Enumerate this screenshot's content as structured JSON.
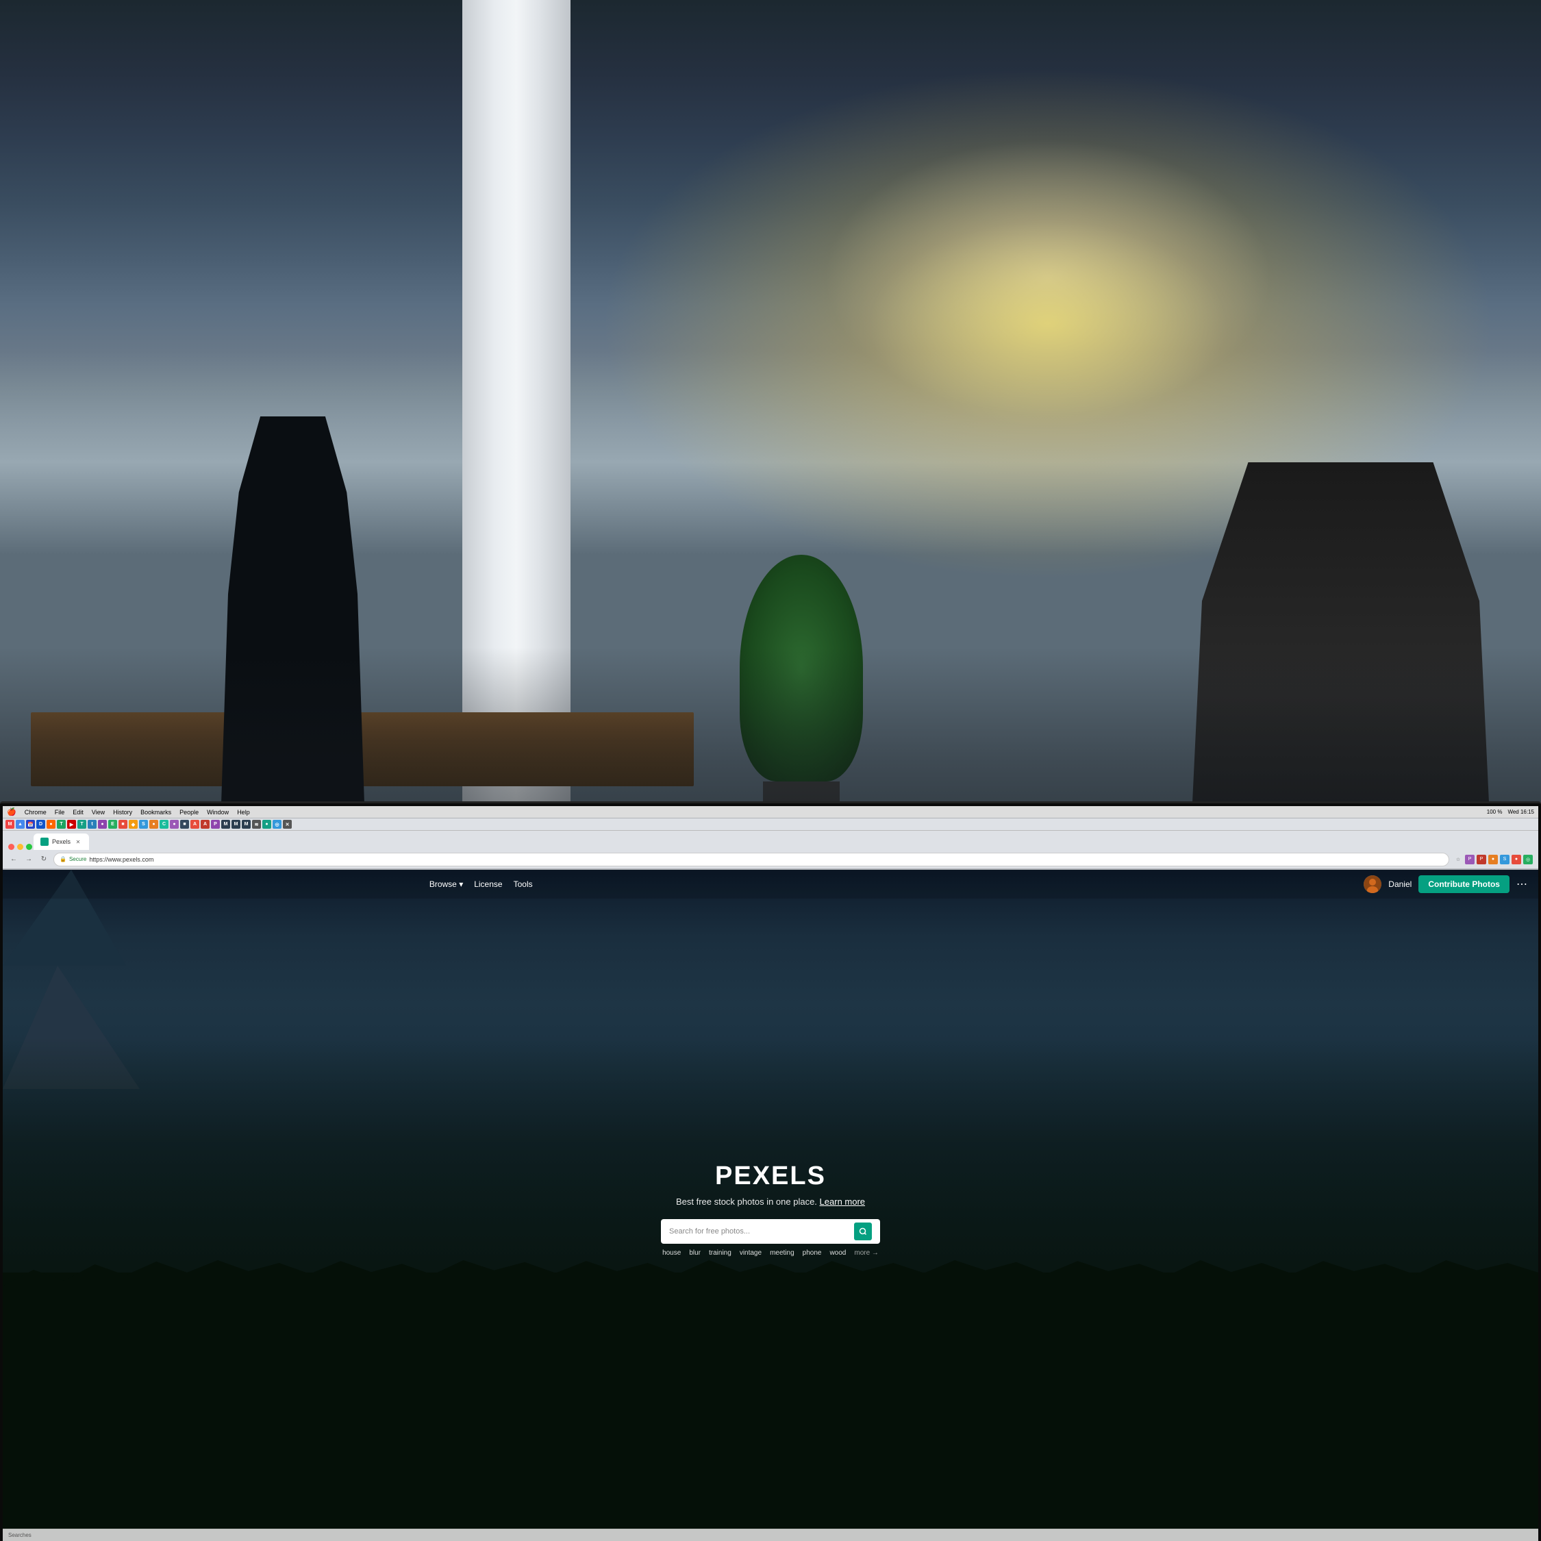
{
  "background": {
    "alt": "Office background with bokeh lighting"
  },
  "screen": {
    "bezel_color": "#0a0a0a"
  },
  "macos_menubar": {
    "apple_menu": "🍎",
    "items": [
      "Chrome",
      "File",
      "Edit",
      "View",
      "History",
      "Bookmarks",
      "People",
      "Window",
      "Help"
    ],
    "right_items": [
      "100 %",
      "Wed 16:15"
    ]
  },
  "browser": {
    "tab": {
      "title": "Pexels",
      "favicon_color": "#05a081"
    },
    "address": {
      "secure_label": "Secure",
      "url": "https://www.pexels.com"
    },
    "toolbar_btns": [
      "←",
      "→",
      "↻"
    ]
  },
  "pexels": {
    "nav": {
      "browse_label": "Browse ▾",
      "license_label": "License",
      "tools_label": "Tools",
      "user_name": "Daniel",
      "contribute_label": "Contribute Photos",
      "more_icon": "⋯"
    },
    "hero": {
      "logo": "PEXELS",
      "tagline": "Best free stock photos in one place.",
      "learn_more": "Learn more",
      "search_placeholder": "Search for free photos...",
      "suggestions": [
        "house",
        "blur",
        "training",
        "vintage",
        "meeting",
        "phone",
        "wood",
        "more →"
      ]
    }
  },
  "status_bar": {
    "text": "Searches"
  }
}
